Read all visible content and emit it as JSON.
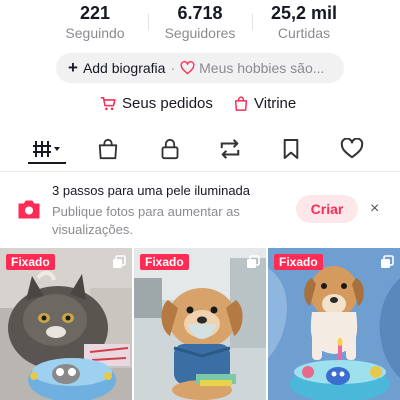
{
  "stats": {
    "following": {
      "value": "221",
      "label": "Seguindo"
    },
    "followers": {
      "value": "6.718",
      "label": "Seguidores"
    },
    "likes": {
      "value": "25,2 mil",
      "label": "Curtidas"
    }
  },
  "bio": {
    "add_label": "Add biografia",
    "separator": "·",
    "hobbies_text": "Meus hobbies são..."
  },
  "links": {
    "orders_label": "Seus pedidos",
    "shop_label": "Vitrine"
  },
  "tabs": [
    {
      "icon": "video-grid-icon",
      "selected": true
    },
    {
      "icon": "shopping-bag-icon",
      "selected": false
    },
    {
      "icon": "lock-icon",
      "selected": false
    },
    {
      "icon": "repost-icon",
      "selected": false
    },
    {
      "icon": "bookmark-icon",
      "selected": false
    },
    {
      "icon": "heart-icon",
      "selected": false
    }
  ],
  "promo": {
    "title": "3 passos para uma pele iluminada",
    "subtitle": "Publique fotos para aumentar as visualizações.",
    "cta_label": "Criar",
    "close_glyph": "×"
  },
  "videos": [
    {
      "badge": "Fixado",
      "subject": "gray cat with birthday cake"
    },
    {
      "badge": "Fixado",
      "subject": "puppy with nebulizer mask"
    },
    {
      "badge": "Fixado",
      "subject": "dog with birthday cake"
    }
  ],
  "colors": {
    "accent": "#fe2c55",
    "text": "#161823",
    "muted": "#8a8b91",
    "pill_bg": "#f1f1f2"
  }
}
